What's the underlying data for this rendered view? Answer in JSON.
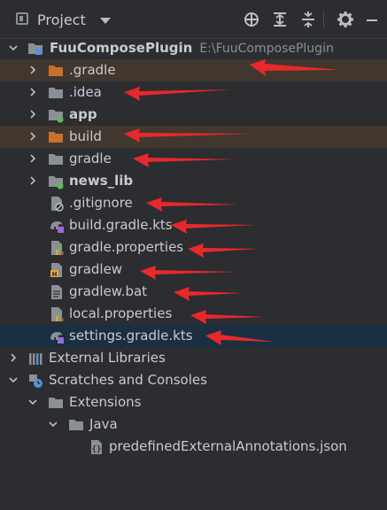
{
  "toolbar": {
    "title": "Project",
    "buttons": [
      "locate-icon",
      "expand-all-icon",
      "collapse-all-icon",
      "gear-icon",
      "minimize-icon"
    ]
  },
  "tree": {
    "root": {
      "name": "FuuComposePlugin",
      "path": "E:\\FuuComposePlugin"
    },
    "items": [
      {
        "label": ".gradle"
      },
      {
        "label": ".idea"
      },
      {
        "label": "app"
      },
      {
        "label": "build"
      },
      {
        "label": "gradle"
      },
      {
        "label": "news_lib"
      },
      {
        "label": ".gitignore"
      },
      {
        "label": "build.gradle.kts"
      },
      {
        "label": "gradle.properties"
      },
      {
        "label": "gradlew"
      },
      {
        "label": "gradlew.bat"
      },
      {
        "label": "local.properties"
      },
      {
        "label": "settings.gradle.kts"
      }
    ],
    "external_libraries": "External Libraries",
    "scratches": "Scratches and Consoles",
    "extensions": "Extensions",
    "java": "Java",
    "json_file": "predefinedExternalAnnotations.json"
  },
  "colors": {
    "arrow": "#e8282b",
    "selection": "#1b2f42",
    "excluded_highlight": "#41372e",
    "excluded_folder": "#c9702a",
    "folder": "#8c8f96",
    "module_dot": "#5fb85a"
  }
}
